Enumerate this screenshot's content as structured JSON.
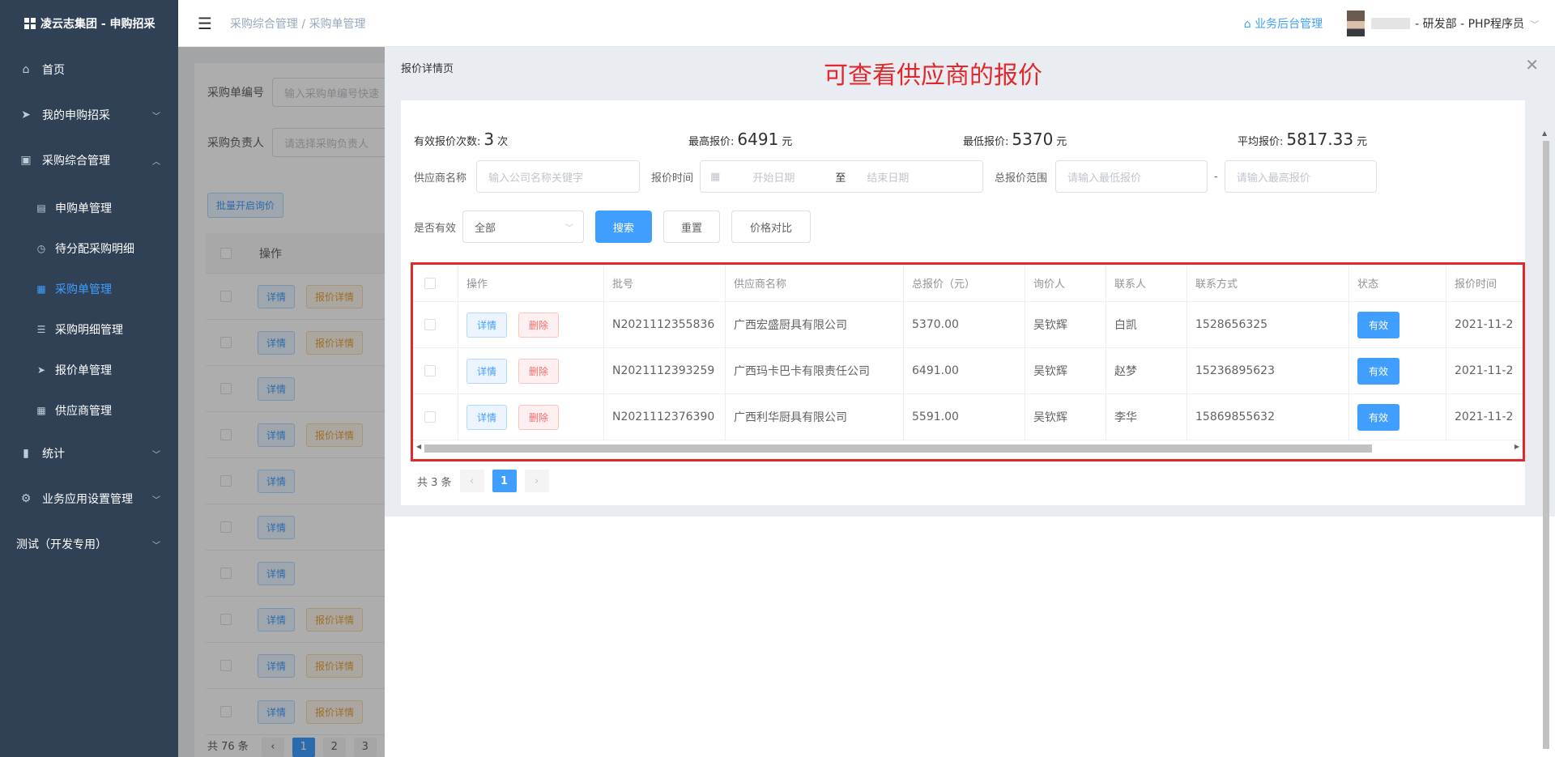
{
  "app": {
    "title": "凌云志集团 - 申购招采"
  },
  "sidebar": {
    "items": [
      {
        "label": "首页",
        "icon": "home-icon"
      },
      {
        "label": "我的申购招采",
        "icon": "send-icon"
      },
      {
        "label": "采购综合管理",
        "icon": "chart-icon"
      }
    ],
    "sub_items": [
      {
        "label": "申购单管理",
        "icon": "clipboard-icon"
      },
      {
        "label": "待分配采购明细",
        "icon": "clock-icon"
      },
      {
        "label": "采购单管理",
        "icon": "document-icon",
        "active": true
      },
      {
        "label": "采购明细管理",
        "icon": "sliders-icon"
      },
      {
        "label": "报价单管理",
        "icon": "send-icon"
      },
      {
        "label": "供应商管理",
        "icon": "grid-icon"
      }
    ],
    "bottom_items": [
      {
        "label": "统计",
        "icon": "bar-chart-icon"
      },
      {
        "label": "业务应用设置管理",
        "icon": "gear-icon"
      },
      {
        "label": "测试（开发专用）"
      }
    ]
  },
  "header": {
    "breadcrumb_parent": "采购综合管理",
    "breadcrumb_sep": "/",
    "breadcrumb_current": "采购单管理",
    "biz_link": "业务后台管理",
    "user": "- 研发部 - PHP程序员"
  },
  "background": {
    "label_order_no": "采购单编号",
    "placeholder_order_no": "输入采购单编号快速",
    "label_owner": "采购负责人",
    "placeholder_owner": "请选择采购负责人",
    "batch_btn": "批量开启询价",
    "col_ops": "操作",
    "btn_detail": "详情",
    "btn_quote_detail": "报价详情",
    "rows_with_quote": [
      true,
      true,
      false,
      true,
      false,
      false,
      false,
      true,
      true,
      true
    ],
    "total": "共 76 条",
    "pages": [
      "1",
      "2",
      "3"
    ]
  },
  "drawer": {
    "title": "报价详情页",
    "annotation": "可查看供应商的报价",
    "stats": [
      {
        "label": "有效报价次数:",
        "value": "3",
        "unit": "次"
      },
      {
        "label": "最高报价:",
        "value": "6491",
        "unit": "元"
      },
      {
        "label": "最低报价:",
        "value": "5370",
        "unit": "元"
      },
      {
        "label": "平均报价:",
        "value": "5817.33",
        "unit": "元"
      }
    ],
    "filters": {
      "supplier_label": "供应商名称",
      "supplier_placeholder": "输入公司名称关键字",
      "time_label": "报价时间",
      "start_placeholder": "开始日期",
      "range_sep": "至",
      "end_placeholder": "结束日期",
      "price_label": "总报价范围",
      "min_placeholder": "请输入最低报价",
      "price_sep": "-",
      "max_placeholder": "请输入最高报价",
      "valid_label": "是否有效",
      "valid_value": "全部",
      "search_btn": "搜索",
      "reset_btn": "重置",
      "compare_btn": "价格对比"
    },
    "table": {
      "headers": [
        "操作",
        "批号",
        "供应商名称",
        "总报价（元）",
        "询价人",
        "联系人",
        "联系方式",
        "状态",
        "报价时间"
      ],
      "btn_detail": "详情",
      "btn_delete": "删除",
      "rows": [
        {
          "batch": "N2021112355836",
          "supplier": "广西宏盛厨具有限公司",
          "price": "5370.00",
          "inquirer": "吴钦辉",
          "contact": "白凯",
          "phone": "1528656325",
          "status": "有效",
          "time": "2021-11-2"
        },
        {
          "batch": "N2021112393259",
          "supplier": "广西玛卡巴卡有限责任公司",
          "price": "6491.00",
          "inquirer": "吴钦辉",
          "contact": "赵梦",
          "phone": "15236895623",
          "status": "有效",
          "time": "2021-11-2"
        },
        {
          "batch": "N2021112376390",
          "supplier": "广西利华厨具有限公司",
          "price": "5591.00",
          "inquirer": "吴钦辉",
          "contact": "李华",
          "phone": "15869855632",
          "status": "有效",
          "time": "2021-11-2"
        }
      ]
    },
    "pager": {
      "total": "共 3 条",
      "current": "1"
    }
  },
  "colors": {
    "primary": "#409eff",
    "sidebar": "#304156",
    "annotation": "#e3282c"
  }
}
